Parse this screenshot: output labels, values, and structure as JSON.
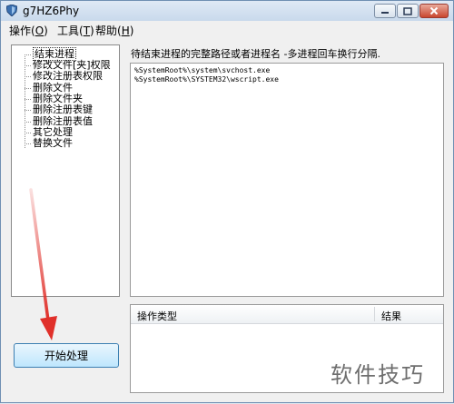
{
  "window": {
    "title": "g7HZ6Phy",
    "controls": {
      "minimize": "minimize",
      "maximize": "maximize",
      "close": "close"
    }
  },
  "menubar": {
    "items": [
      {
        "label": "操作(",
        "key": "O",
        "tail": ")"
      },
      {
        "label": "工具(",
        "key": "T",
        "tail": ")"
      },
      {
        "label": "帮助(",
        "key": "H",
        "tail": ")"
      }
    ]
  },
  "tree": {
    "items": [
      "结束进程",
      "修改文件[夹]权限",
      "修改注册表权限",
      "删除文件",
      "删除文件夹",
      "删除注册表键",
      "删除注册表值",
      "其它处理",
      "替换文件"
    ],
    "selected_index": 0
  },
  "main": {
    "instruction": "待结束进程的完整路径或者进程名 -多进程回车换行分隔.",
    "paths": [
      "%SystemRoot%\\system\\svchost.exe",
      "%SystemRoot%\\SYSTEM32\\wscript.exe"
    ]
  },
  "results": {
    "columns": [
      "操作类型",
      "结果"
    ],
    "rows": []
  },
  "start_button": {
    "label": "开始处理"
  },
  "watermark": {
    "text": "软件技巧"
  },
  "colors": {
    "annotation_arrow": "#e0302a",
    "button_border": "#3c7fb1"
  },
  "icons": {
    "app": "shield-icon",
    "annotation": "red-arrow-icon"
  }
}
